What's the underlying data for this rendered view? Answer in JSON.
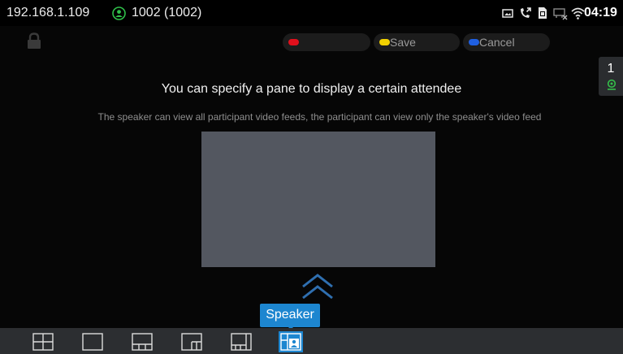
{
  "status_bar": {
    "ip": "192.168.1.109",
    "account": "1002 (1002)",
    "time": "04:19",
    "icons": [
      "account-icon",
      "screenshot-icon",
      "call-forward-icon",
      "sim-icon",
      "network-off-icon",
      "wifi-icon"
    ]
  },
  "lock": {
    "icon": "lock-icon"
  },
  "key_buttons": {
    "red": {
      "label": "",
      "color": "#e0101c"
    },
    "yellow": {
      "label": "Save",
      "color": "#f0d000"
    },
    "blue": {
      "label": "Cancel",
      "color": "#1f5fe0"
    }
  },
  "participants": {
    "count": "1",
    "icon": "camera-icon"
  },
  "content": {
    "headline": "You can specify a pane to display a certain attendee",
    "subline": "The speaker can view all participant video feeds, the participant can view only the speaker's video feed"
  },
  "tooltip": {
    "label": "Speaker"
  },
  "layouts": [
    {
      "name": "grid-4",
      "icon": "layout-grid-icon",
      "active": false
    },
    {
      "name": "single",
      "icon": "layout-single-icon",
      "active": false
    },
    {
      "name": "main-bottom",
      "icon": "layout-main-bottom-icon",
      "active": false
    },
    {
      "name": "main-corner",
      "icon": "layout-main-corner-icon",
      "active": false
    },
    {
      "name": "main-side-bottom",
      "icon": "layout-main-side-icon",
      "active": false
    },
    {
      "name": "speaker",
      "icon": "layout-speaker-icon",
      "active": true
    }
  ],
  "colors": {
    "accent": "#1d86d0",
    "account_green": "#2fc14a",
    "pane": "#535760"
  }
}
